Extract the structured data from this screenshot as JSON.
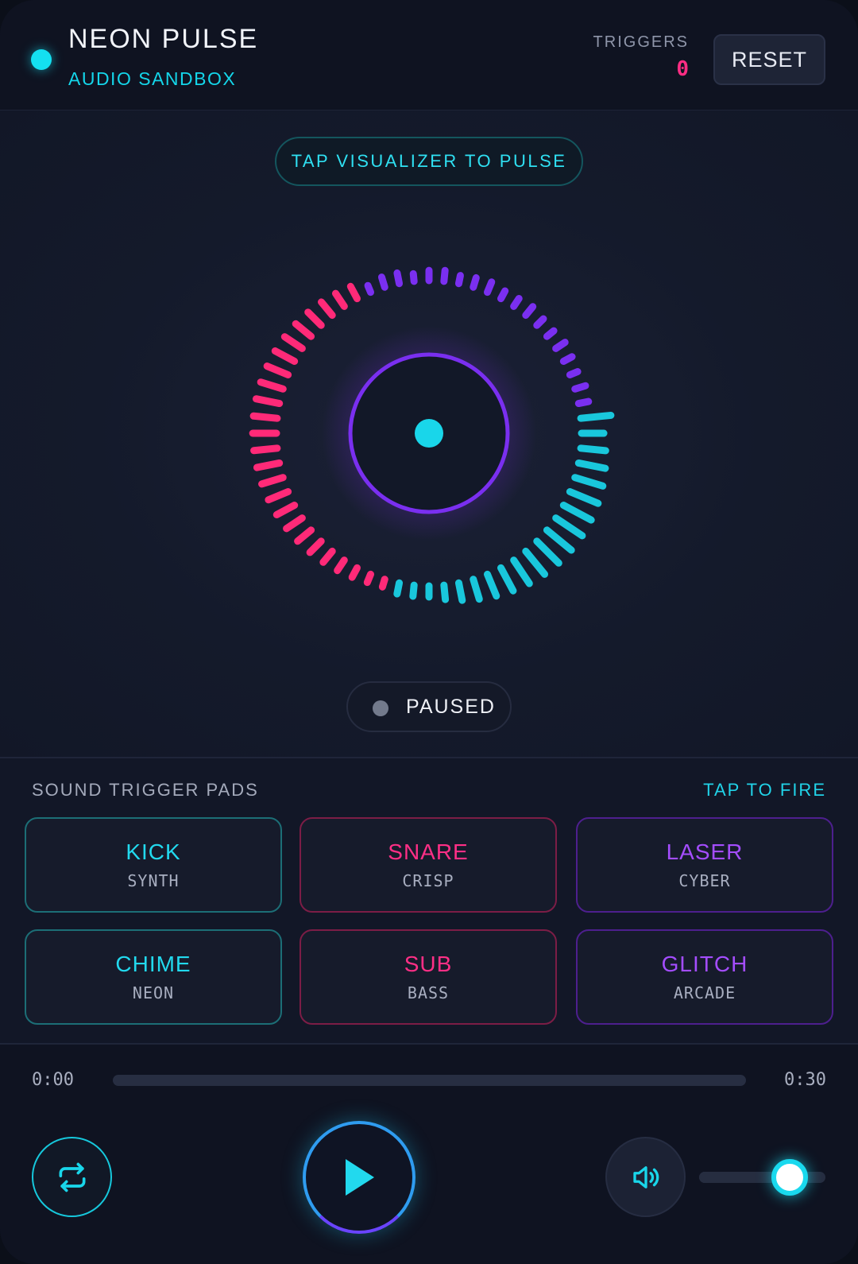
{
  "header": {
    "title": "NEON PULSE",
    "subtitle": "AUDIO SANDBOX",
    "triggers_label": "TRIGGERS",
    "triggers_count": "0",
    "reset_label": "RESET"
  },
  "visualizer": {
    "hint": "TAP VISUALIZER TO PULSE",
    "status": "PAUSED",
    "colors": {
      "pink": "#ff2a78",
      "purple": "#7a2ff0",
      "cyan": "#19c7dc"
    }
  },
  "pads": {
    "title": "SOUND TRIGGER PADS",
    "hint": "TAP TO FIRE",
    "items": [
      {
        "name": "KICK",
        "sub": "SYNTH",
        "color": "cyan"
      },
      {
        "name": "SNARE",
        "sub": "CRISP",
        "color": "pink"
      },
      {
        "name": "LASER",
        "sub": "CYBER",
        "color": "purple"
      },
      {
        "name": "CHIME",
        "sub": "NEON",
        "color": "cyan"
      },
      {
        "name": "SUB",
        "sub": "BASS",
        "color": "pink"
      },
      {
        "name": "GLITCH",
        "sub": "ARCADE",
        "color": "purple"
      }
    ]
  },
  "player": {
    "time_current": "0:00",
    "time_total": "0:30",
    "progress": 0,
    "volume": 0.72,
    "icons": {
      "loop": "repeat-icon",
      "play": "play-icon",
      "volume": "volume-icon"
    }
  }
}
